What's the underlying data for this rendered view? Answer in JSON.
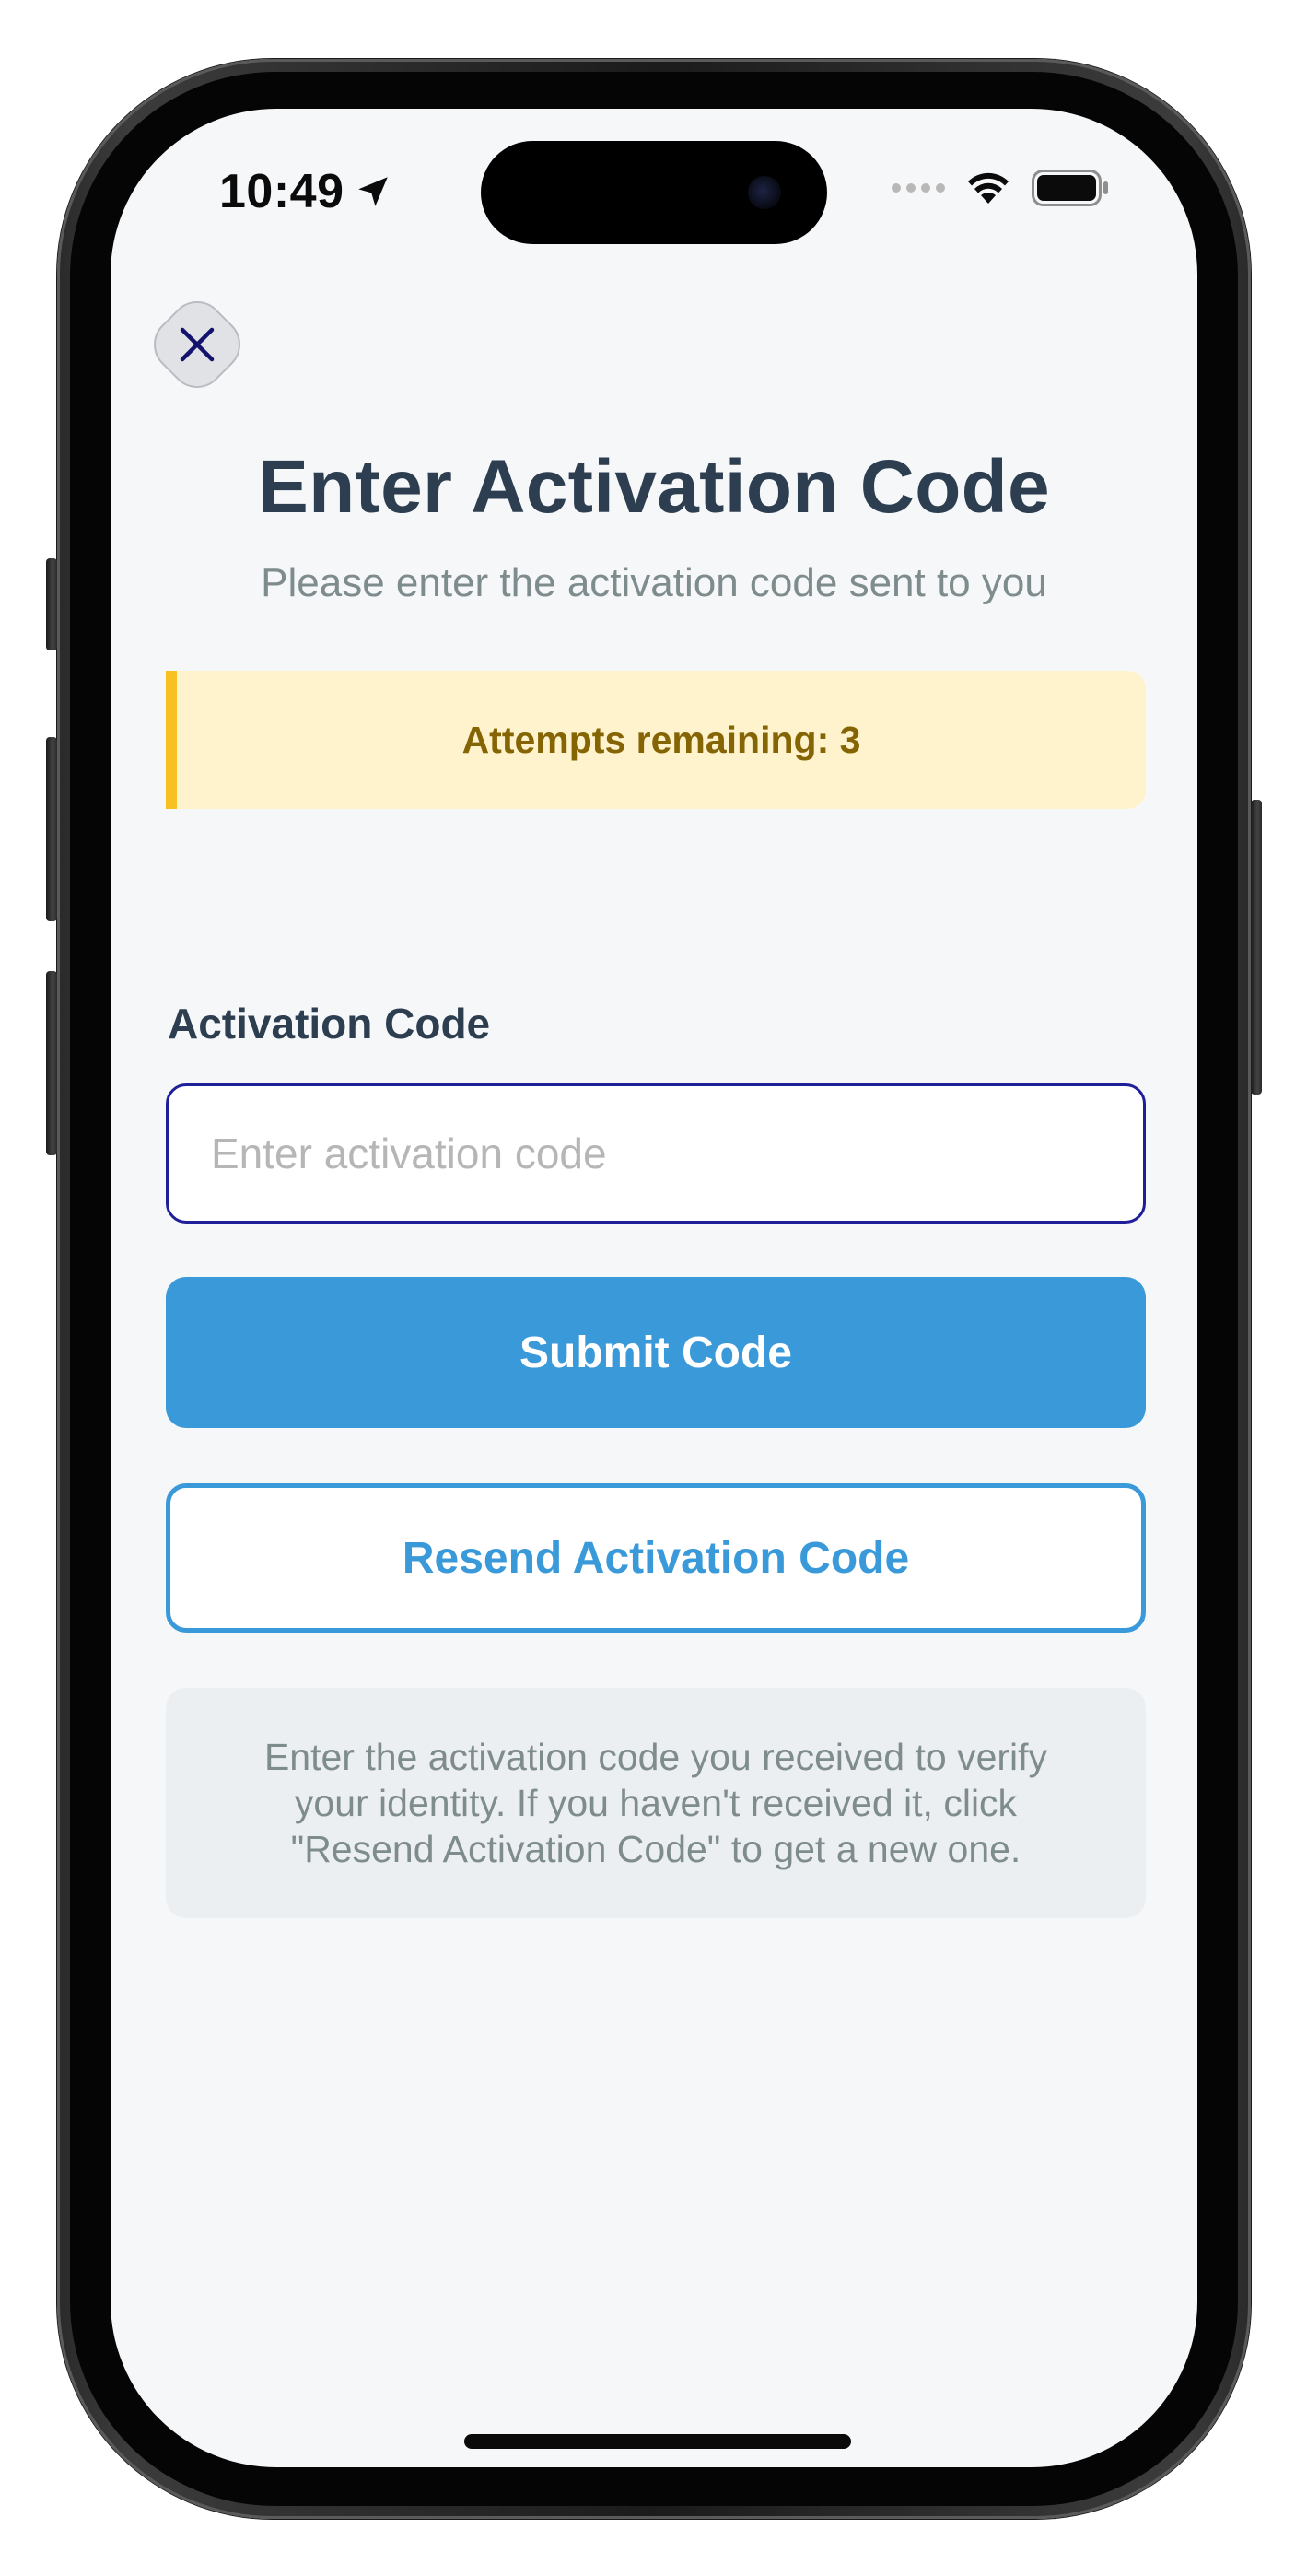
{
  "status_bar": {
    "time": "10:49",
    "location_icon": "location-arrow-icon",
    "cellular_icon": "cellular-dots-icon",
    "wifi_icon": "wifi-icon",
    "battery_icon": "battery-icon"
  },
  "header": {
    "close_icon": "close-icon",
    "title": "Enter Activation Code",
    "subtitle": "Please enter the activation code sent to you"
  },
  "attempts": {
    "text": "Attempts remaining: 3"
  },
  "form": {
    "label": "Activation Code",
    "input_value": "",
    "input_placeholder": "Enter activation code",
    "submit_label": "Submit Code",
    "resend_label": "Resend Activation Code"
  },
  "info": {
    "line1": "Enter the activation code you received to verify",
    "line2": "your identity. If you haven't received it, click",
    "line3": "\"Resend Activation Code\" to get a new one."
  },
  "colors": {
    "title": "#2c3e50",
    "subtitle": "#7f8c8d",
    "warning_bg": "#fef3cd",
    "warning_border": "#f7c124",
    "warning_text": "#856404",
    "primary": "#3a9ad9",
    "input_border": "#1f1f9a",
    "info_bg": "#eceff1",
    "screen_bg": "#f6f7f9"
  }
}
